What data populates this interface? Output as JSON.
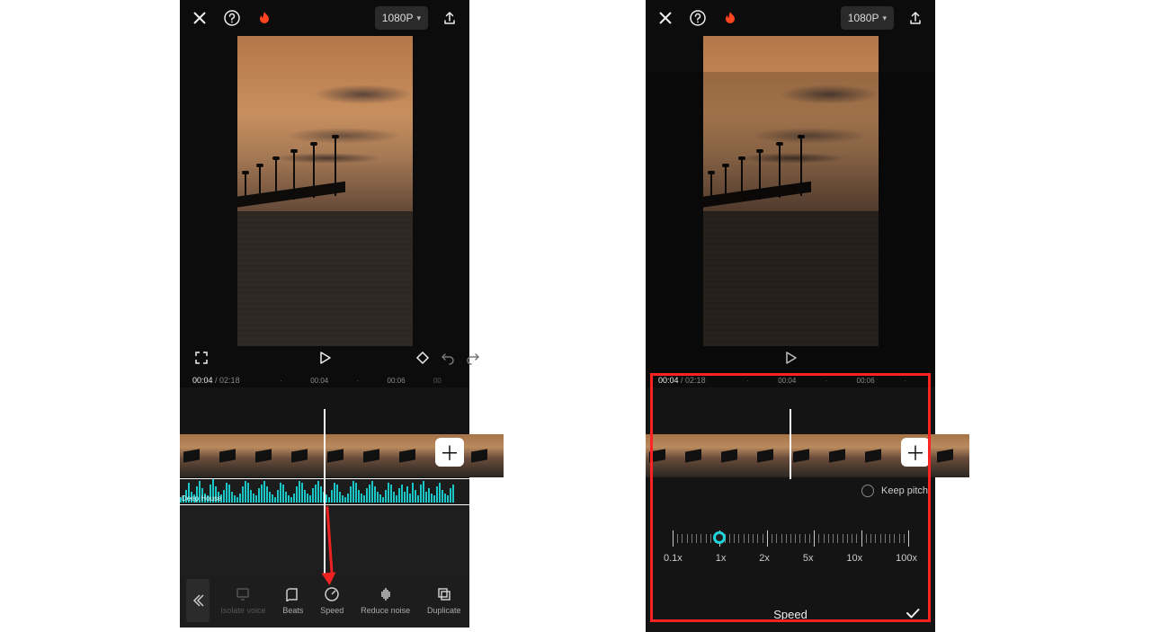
{
  "header": {
    "resolution_label": "1080P"
  },
  "playback": {
    "current_time": "00:04",
    "duration": "02:18",
    "marks": [
      "00:04",
      "00:06"
    ]
  },
  "audio_track": {
    "label": "Deep House"
  },
  "toolbar": {
    "isolate_voice": "Isolate voice",
    "beats": "Beats",
    "speed": "Speed",
    "reduce_noise": "Reduce noise",
    "duplicate": "Duplicate"
  },
  "speed_panel": {
    "keep_pitch": "Keep pitch",
    "labels": [
      "0.1x",
      "1x",
      "2x",
      "5x",
      "10x",
      "100x"
    ],
    "title": "Speed",
    "value": "1x"
  }
}
